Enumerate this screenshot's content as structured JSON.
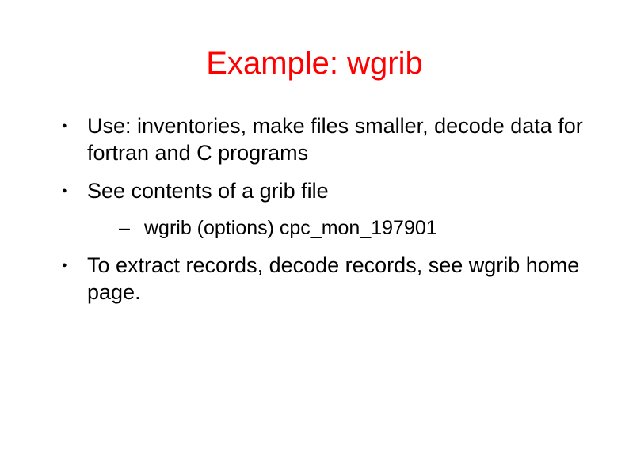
{
  "slide": {
    "title": "Example: wgrib",
    "bullets": [
      {
        "text": "Use: inventories, make files smaller, decode data for fortran and C programs"
      },
      {
        "text": "See contents of a grib file",
        "sub": [
          "wgrib (options) cpc_mon_197901"
        ]
      },
      {
        "text": "To extract records, decode records, see wgrib home page."
      }
    ]
  }
}
